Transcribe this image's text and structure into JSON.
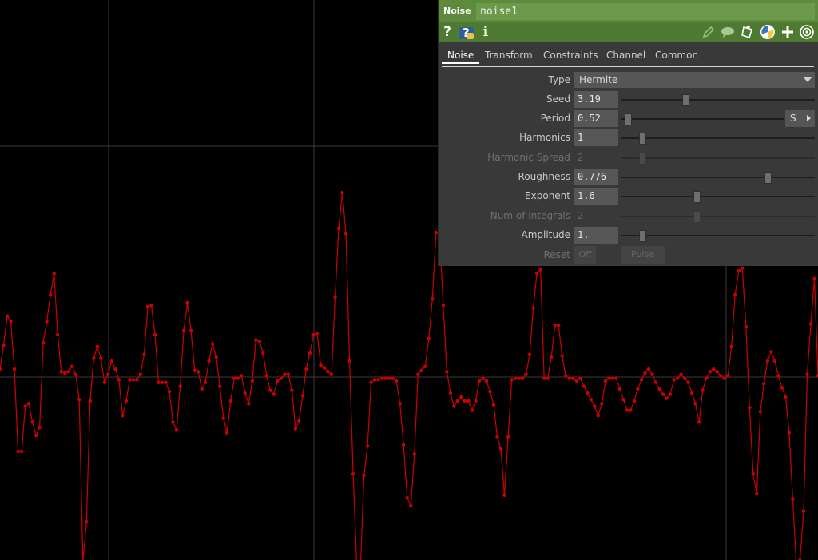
{
  "viewer": {
    "background": "#000000",
    "grid_color": "#3a3a3a",
    "curve_color": "#cc0000",
    "channel_samples": [
      0.097,
      0.387,
      0.742,
      0.677,
      0.097,
      -0.903,
      -0.903,
      -0.355,
      -0.323,
      -0.548,
      -0.71,
      -0.613,
      0.419,
      0.677,
      1.0,
      1.258,
      0.516,
      0.065,
      0.048,
      0.065,
      0.129,
      0.032,
      -0.274,
      -2.242,
      -1.758,
      -0.29,
      0.226,
      0.371,
      0.226,
      -0.065,
      0.032,
      0.194,
      0.097,
      -0.032,
      -0.468,
      -0.29,
      -0.032,
      -0.032,
      -0.032,
      0.032,
      0.274,
      0.855,
      0.871,
      0.516,
      -0.065,
      -0.065,
      -0.065,
      -0.177,
      -0.548,
      -0.645,
      -0.113,
      0.565,
      0.903,
      0.565,
      0.081,
      0.065,
      -0.145,
      -0.065,
      0.194,
      0.403,
      0.242,
      -0.113,
      -0.5,
      -0.677,
      -0.29,
      -0.016,
      -0.016,
      0.016,
      -0.194,
      -0.323,
      -0.048,
      0.452,
      0.435,
      0.29,
      0.016,
      -0.161,
      -0.21,
      -0.048,
      -0.016,
      0.032,
      0.032,
      -0.161,
      -0.629,
      -0.532,
      -0.226,
      0.097,
      0.29,
      0.516,
      0.532,
      0.145,
      0.113,
      0.065,
      0.032,
      0.968,
      1.806,
      2.242,
      1.742,
      0.194,
      -1.177,
      -2.29,
      -2.371,
      -1.194,
      -0.839,
      -0.065,
      -0.032,
      -0.032,
      -0.016,
      -0.016,
      -0.016,
      -0.016,
      -0.048,
      -0.323,
      -0.823,
      -1.468,
      -1.565,
      -0.935,
      0.032,
      0.081,
      0.129,
      0.468,
      0.952,
      1.758,
      1.726,
      0.871,
      0.065,
      -0.194,
      -0.355,
      -0.29,
      -0.242,
      -0.29,
      -0.29,
      -0.403,
      -0.29,
      -0.048,
      -0.016,
      -0.048,
      -0.177,
      -0.339,
      -0.726,
      -0.871,
      -1.435,
      -0.726,
      -0.032,
      -0.016,
      -0.016,
      -0.016,
      0.032,
      0.274,
      0.839,
      1.258,
      1.306,
      -0.016,
      -0.016,
      0.242,
      0.629,
      0.629,
      0.258,
      0.016,
      -0.016,
      -0.016,
      -0.048,
      -0.016,
      -0.113,
      -0.194,
      -0.274,
      -0.355,
      -0.468,
      -0.323,
      -0.048,
      -0.016,
      -0.016,
      -0.016,
      -0.145,
      -0.274,
      -0.403,
      -0.403,
      -0.29,
      -0.145,
      -0.032,
      0.048,
      0.097,
      0.032,
      -0.065,
      -0.145,
      -0.21,
      -0.258,
      -0.21,
      -0.032,
      -0.016,
      0.032,
      -0.016,
      -0.065,
      -0.194,
      -0.323,
      -0.548,
      -0.161,
      -0.016,
      0.065,
      0.097,
      0.065,
      0.016,
      -0.016,
      0.016,
      0.371,
      1.0,
      1.29,
      1.323,
      0.613,
      -0.371,
      -1.177,
      -1.419,
      -0.419,
      -0.081,
      0.194,
      0.306,
      0.194,
      0.016,
      -0.129,
      -0.242,
      -0.677,
      -1.484,
      -2.29,
      -2.226,
      -1.629,
      0.032,
      0.645,
      1.194,
      0.016
    ]
  },
  "panel": {
    "op_type": "Noise",
    "op_name": "noise1",
    "icons": [
      "help-icon",
      "python-help-icon",
      "info-icon",
      "pencil-icon",
      "comment-icon",
      "clipboard-icon",
      "python-icon",
      "plus-icon",
      "target-icon"
    ],
    "tabs": [
      "Noise",
      "Transform",
      "Constraints",
      "Channel",
      "Common"
    ],
    "params": {
      "type": {
        "label": "Type",
        "value": "Hermite"
      },
      "seed": {
        "label": "Seed",
        "value": "3.19",
        "level": 0.33
      },
      "period": {
        "label": "Period",
        "value": "0.52",
        "level": 0.02,
        "button": "S"
      },
      "harmonics": {
        "label": "Harmonics",
        "value": "1",
        "level": 0.1
      },
      "harmonic_spread": {
        "label": "Harmonic Spread",
        "value": "2",
        "level": 0.1
      },
      "roughness": {
        "label": "Roughness",
        "value": "0.776",
        "level": 0.77
      },
      "exponent": {
        "label": "Exponent",
        "value": "1.6",
        "level": 0.39
      },
      "num_integrals": {
        "label": "Num of Integrals",
        "value": "2",
        "level": 0.39
      },
      "amplitude": {
        "label": "Amplitude",
        "value": "1.",
        "level": 0.1
      },
      "reset": {
        "label": "Reset",
        "button_off": "Off",
        "button_pulse": "Pulse"
      }
    }
  }
}
